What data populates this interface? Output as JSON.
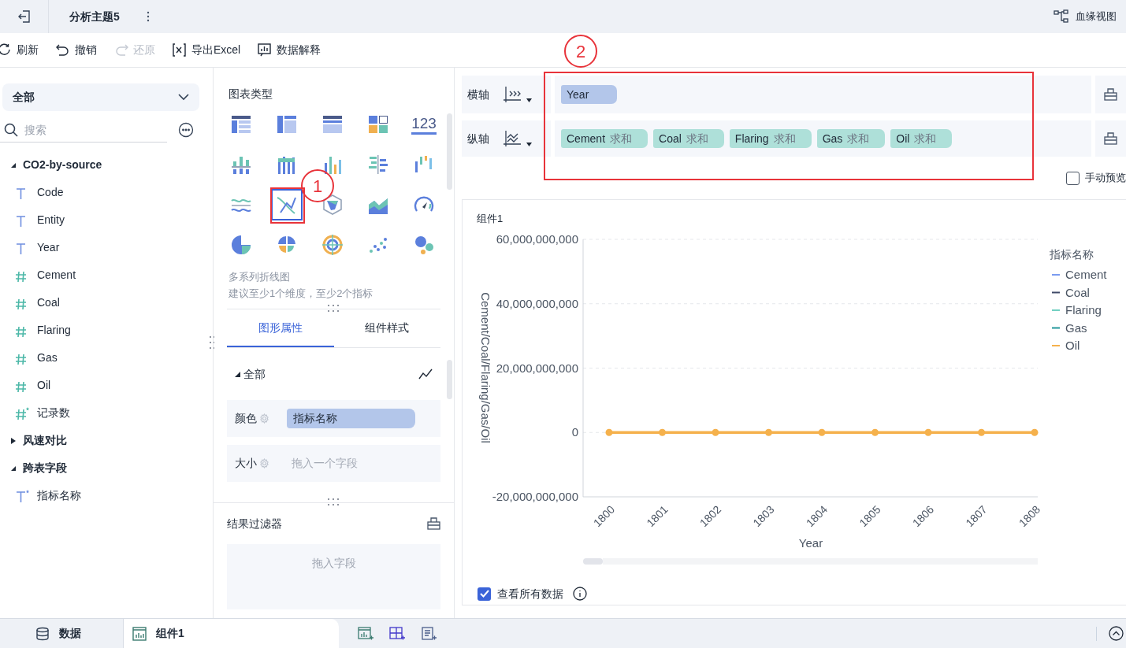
{
  "header": {
    "title": "分析主题5",
    "lineage": "血缘视图"
  },
  "toolbar": [
    {
      "kind": "refresh",
      "label": "刷新",
      "disabled": false
    },
    {
      "kind": "undo",
      "label": "撤销",
      "disabled": false
    },
    {
      "kind": "redo",
      "label": "还原",
      "disabled": true
    },
    {
      "kind": "excel",
      "label": "导出Excel",
      "disabled": false
    },
    {
      "kind": "explain",
      "label": "数据解释",
      "disabled": false
    }
  ],
  "sidebar": {
    "dropdown": "全部",
    "search_placeholder": "搜索",
    "groups": [
      {
        "label": "CO2-by-source",
        "expanded": true,
        "children": [
          {
            "label": "Code",
            "kind": "text"
          },
          {
            "label": "Entity",
            "kind": "text"
          },
          {
            "label": "Year",
            "kind": "text"
          },
          {
            "label": "Cement",
            "kind": "number"
          },
          {
            "label": "Coal",
            "kind": "number"
          },
          {
            "label": "Flaring",
            "kind": "number"
          },
          {
            "label": "Gas",
            "kind": "number"
          },
          {
            "label": "Oil",
            "kind": "number"
          },
          {
            "label": "记录数",
            "kind": "calc_number"
          }
        ]
      },
      {
        "label": "风速对比",
        "expanded": false
      },
      {
        "label": "跨表字段",
        "expanded": true,
        "children": [
          {
            "label": "指标名称",
            "kind": "calc_text"
          }
        ]
      }
    ]
  },
  "chart_types": {
    "title": "图表类型",
    "items": [
      {
        "kind": "table",
        "selected": false
      },
      {
        "kind": "pivot",
        "selected": false
      },
      {
        "kind": "detail",
        "selected": false
      },
      {
        "kind": "tiles",
        "selected": false
      },
      {
        "kind": "number",
        "glyph": "123",
        "selected": false
      },
      {
        "kind": "group_bar",
        "selected": false
      },
      {
        "kind": "stack_bar",
        "selected": false
      },
      {
        "kind": "color_bar",
        "selected": false
      },
      {
        "kind": "hbar",
        "selected": false
      },
      {
        "kind": "waterfall",
        "selected": false
      },
      {
        "kind": "wave",
        "selected": false
      },
      {
        "kind": "multiline",
        "selected": true
      },
      {
        "kind": "radar",
        "selected": false
      },
      {
        "kind": "area",
        "selected": false
      },
      {
        "kind": "gauge",
        "selected": false
      },
      {
        "kind": "pie",
        "selected": false
      },
      {
        "kind": "rose",
        "selected": false
      },
      {
        "kind": "donut",
        "selected": false
      },
      {
        "kind": "scatter",
        "selected": false
      },
      {
        "kind": "bubble",
        "selected": false
      }
    ],
    "name": "多系列折线图",
    "hint": "建议至少1个维度，至少2个指标"
  },
  "property_tabs": [
    {
      "label": "图形属性",
      "selected": true
    },
    {
      "label": "组件样式",
      "selected": false
    }
  ],
  "properties": {
    "section": "全部",
    "expanded": true,
    "rows": [
      {
        "label": "颜色",
        "field": "指标名称"
      },
      {
        "label": "大小",
        "placeholder": "拖入一个字段"
      }
    ]
  },
  "result_filter": {
    "title": "结果过滤器",
    "placeholder": "拖入字段"
  },
  "shelves": [
    {
      "label": "横轴",
      "kind": "dimension",
      "chips": [
        {
          "field": "Year",
          "kind": "dimension"
        }
      ]
    },
    {
      "label": "纵轴",
      "kind": "measure",
      "chips": [
        {
          "field": "Cement",
          "agg": "求和",
          "kind": "measure"
        },
        {
          "field": "Coal",
          "agg": "求和",
          "kind": "measure"
        },
        {
          "field": "Flaring",
          "agg": "求和",
          "kind": "measure"
        },
        {
          "field": "Gas",
          "agg": "求和",
          "kind": "measure"
        },
        {
          "field": "Oil",
          "agg": "求和",
          "kind": "measure"
        }
      ]
    }
  ],
  "manual_preview": {
    "label": "手动预览",
    "checked": false
  },
  "component": {
    "title": "组件1",
    "chart_data": {
      "type": "line",
      "xlabel": "Year",
      "ylabel": "Cement/Coal/Flaring/Gas/Oil",
      "legend_title": "指标名称",
      "categories": [
        "1800",
        "1801",
        "1802",
        "1803",
        "1804",
        "1805",
        "1806",
        "1807",
        "1808"
      ],
      "ylim": [
        -20000000000,
        60000000000
      ],
      "yticks": [
        {
          "value": -20000000000,
          "label": "-20,000,000,000"
        },
        {
          "value": 0,
          "label": "0"
        },
        {
          "value": 20000000000,
          "label": "20,000,000,000"
        },
        {
          "value": 40000000000,
          "label": "40,000,000,000"
        },
        {
          "value": 60000000000,
          "label": "60,000,000,000"
        }
      ],
      "grid": true,
      "legend": true,
      "series": [
        {
          "name": "Cement",
          "color": "#7b9cf0",
          "values": [
            null,
            null,
            null,
            null,
            null,
            null,
            null,
            null,
            null
          ]
        },
        {
          "name": "Coal",
          "color": "#3f4a68",
          "values": [
            null,
            null,
            null,
            null,
            null,
            null,
            null,
            null,
            null
          ]
        },
        {
          "name": "Flaring",
          "color": "#72d0c2",
          "values": [
            null,
            null,
            null,
            null,
            null,
            null,
            null,
            null,
            null
          ]
        },
        {
          "name": "Gas",
          "color": "#23979a",
          "values": [
            null,
            null,
            null,
            null,
            null,
            null,
            null,
            null,
            null
          ]
        },
        {
          "name": "Oil",
          "color": "#f5b14c",
          "marker": true,
          "values": [
            0,
            0,
            0,
            0,
            0,
            0,
            0,
            0,
            0
          ]
        }
      ]
    },
    "show_all": {
      "label": "查看所有数据",
      "checked": true
    }
  },
  "bottom_tabs": [
    {
      "kind": "data",
      "label": "数据",
      "selected": false
    },
    {
      "kind": "chart",
      "label": "组件1",
      "selected": true
    }
  ],
  "annotations": [
    {
      "number": "1"
    },
    {
      "number": "2"
    }
  ]
}
